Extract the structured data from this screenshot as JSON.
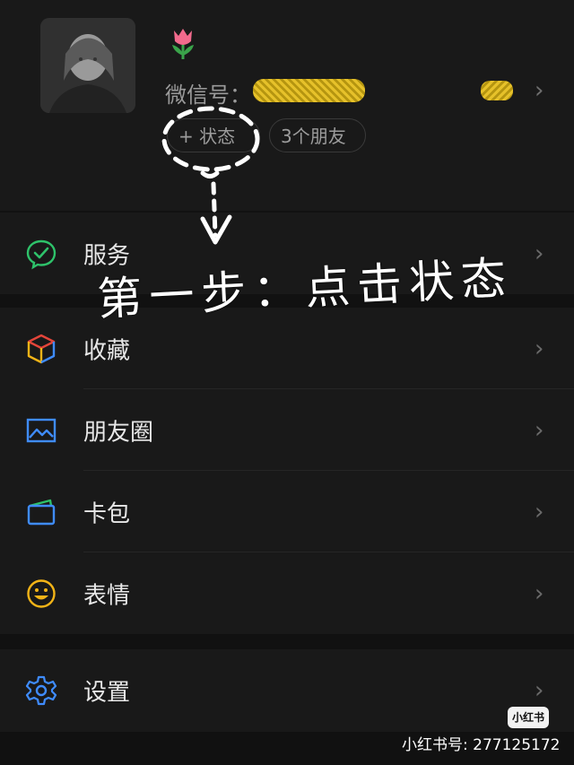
{
  "profile": {
    "wxid_label": "微信号：",
    "status_button": "+ 状态",
    "friends_button": "3个朋友"
  },
  "menu": {
    "services": "服务",
    "favorites": "收藏",
    "moments": "朋友圈",
    "cards": "卡包",
    "stickers": "表情",
    "settings": "设置"
  },
  "annotation": {
    "note": "第一步：点击状态"
  },
  "watermark": {
    "badge": "小红书",
    "id_text": "小红书号: 277125172"
  },
  "colors": {
    "services_icon": "#2ec26a",
    "moments_icon": "#3f8cff",
    "settings_icon": "#3f8cff",
    "stickers_icon": "#f3b417"
  }
}
